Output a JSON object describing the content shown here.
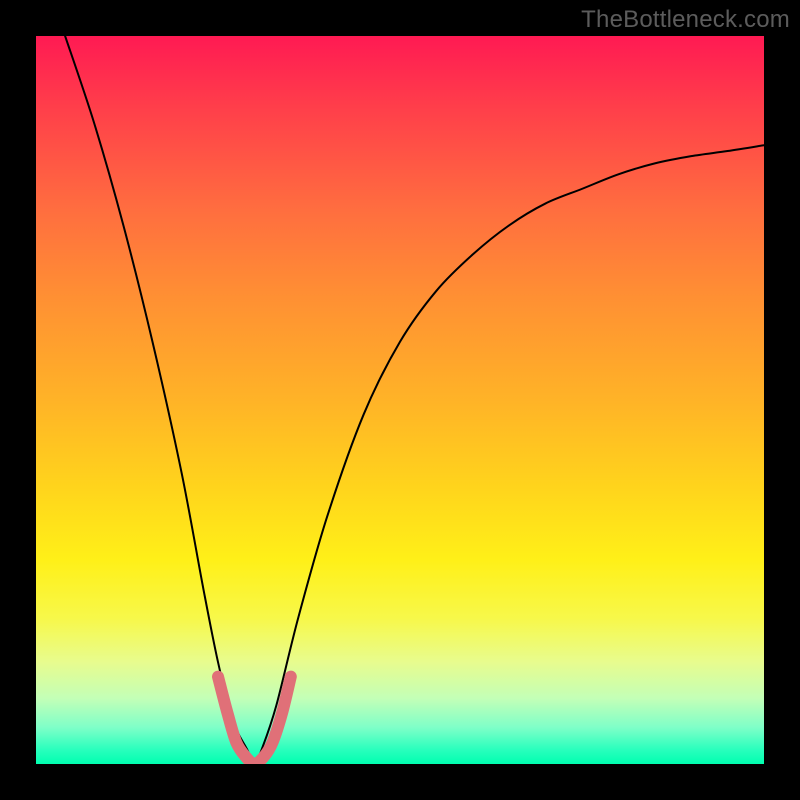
{
  "watermark": "TheBottleneck.com",
  "chart_data": {
    "type": "line",
    "title": "",
    "xlabel": "",
    "ylabel": "",
    "xlim": [
      0,
      100
    ],
    "ylim": [
      0,
      100
    ],
    "grid": false,
    "legend": false,
    "annotations": [],
    "series": [
      {
        "name": "bottleneck-curve",
        "color": "#000000",
        "x": [
          4,
          8,
          12,
          16,
          20,
          23,
          25,
          27,
          29,
          30,
          31,
          33,
          36,
          40,
          45,
          50,
          55,
          60,
          65,
          70,
          75,
          80,
          85,
          90,
          95,
          100
        ],
        "y": [
          100,
          88,
          74,
          58,
          40,
          24,
          14,
          6,
          2,
          0,
          2,
          8,
          20,
          34,
          48,
          58,
          65,
          70,
          74,
          77,
          79,
          81,
          82.5,
          83.5,
          84.2,
          85
        ]
      },
      {
        "name": "highlight-bottom",
        "color": "#e07078",
        "x": [
          25,
          26.3,
          27.5,
          28.8,
          30,
          31.3,
          32.5,
          33.8,
          35
        ],
        "y": [
          12,
          7,
          3,
          1,
          0,
          1,
          3,
          7,
          12
        ]
      }
    ],
    "background_gradient": {
      "top": "#ff1a53",
      "bottom": "#00ffb0"
    }
  }
}
